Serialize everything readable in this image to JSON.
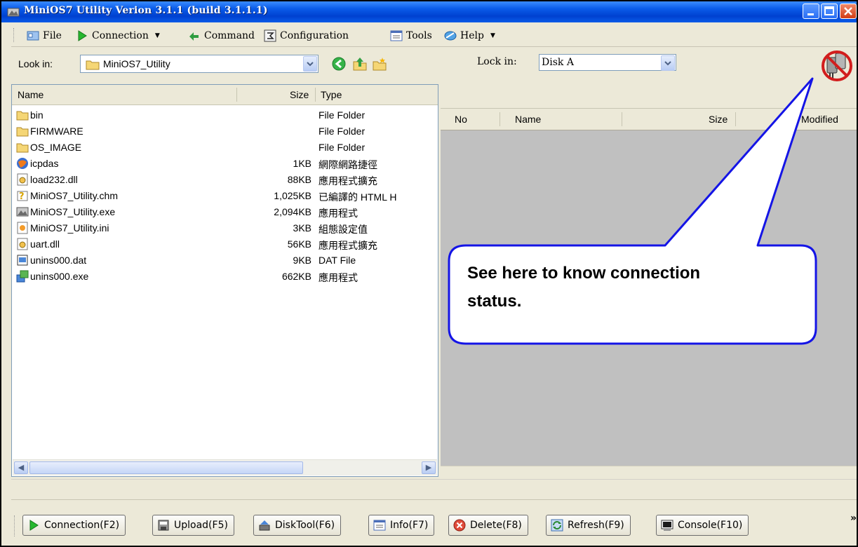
{
  "window": {
    "title": "MiniOS7 Utility Verion 3.1.1 (build 3.1.1.1)",
    "accent_color": "#0a5be8",
    "controls": [
      "minimize-icon",
      "maximize-icon",
      "close-icon"
    ]
  },
  "menubar": {
    "items": [
      {
        "label": "File",
        "icon": "file-icon"
      },
      {
        "label": "Connection",
        "icon": "play-icon",
        "has_dropdown": true
      },
      {
        "label": "Command",
        "icon": "command-icon"
      },
      {
        "label": "Configuration",
        "icon": "configuration-icon"
      },
      {
        "label": "Tools",
        "icon": "tools-icon"
      },
      {
        "label": "Help",
        "icon": "help-icon",
        "has_dropdown": true
      }
    ]
  },
  "left_panel": {
    "lookin_label": "Look in:",
    "lookin_value": "MiniOS7_Utility",
    "columns": [
      "Name",
      "Size",
      "Type"
    ],
    "files": [
      {
        "name": "bin",
        "size": "",
        "type": "File Folder",
        "icon": "folder-icon"
      },
      {
        "name": "FIRMWARE",
        "size": "",
        "type": "File Folder",
        "icon": "folder-icon"
      },
      {
        "name": "OS_IMAGE",
        "size": "",
        "type": "File Folder",
        "icon": "folder-icon"
      },
      {
        "name": "icpdas",
        "size": "1KB",
        "type": "網際網路捷徑",
        "icon": "internet-shortcut-icon"
      },
      {
        "name": "load232.dll",
        "size": "88KB",
        "type": "應用程式擴充",
        "icon": "dll-icon"
      },
      {
        "name": "MiniOS7_Utility.chm",
        "size": "1,025KB",
        "type": "已編譯的 HTML H",
        "icon": "help-file-icon"
      },
      {
        "name": "MiniOS7_Utility.exe",
        "size": "2,094KB",
        "type": "應用程式",
        "icon": "app-icon"
      },
      {
        "name": "MiniOS7_Utility.ini",
        "size": "3KB",
        "type": "組態設定值",
        "icon": "ini-icon"
      },
      {
        "name": "uart.dll",
        "size": "56KB",
        "type": "應用程式擴充",
        "icon": "dll-icon"
      },
      {
        "name": "unins000.dat",
        "size": "9KB",
        "type": "DAT File",
        "icon": "dat-icon"
      },
      {
        "name": "unins000.exe",
        "size": "662KB",
        "type": "應用程式",
        "icon": "installer-icon"
      }
    ]
  },
  "right_panel": {
    "lookin_label": "Lock in:",
    "lookin_value": "Disk A",
    "columns": [
      "No",
      "Name",
      "Size",
      "Modified"
    ],
    "connection_status_icon": "disconnected-icon"
  },
  "bottom_toolbar": {
    "buttons": [
      {
        "label": "Connection(F2)",
        "icon": "play-icon"
      },
      {
        "label": "Upload(F5)",
        "icon": "upload-icon"
      },
      {
        "label": "DiskTool(F6)",
        "icon": "disktool-icon"
      },
      {
        "label": "Info(F7)",
        "icon": "info-icon"
      },
      {
        "label": "Delete(F8)",
        "icon": "delete-icon"
      },
      {
        "label": "Refresh(F9)",
        "icon": "refresh-icon"
      },
      {
        "label": "Console(F10)",
        "icon": "console-icon"
      }
    ],
    "overflow": "»"
  },
  "callout": {
    "text_line1": "See here to know connection",
    "text_line2": "status."
  }
}
